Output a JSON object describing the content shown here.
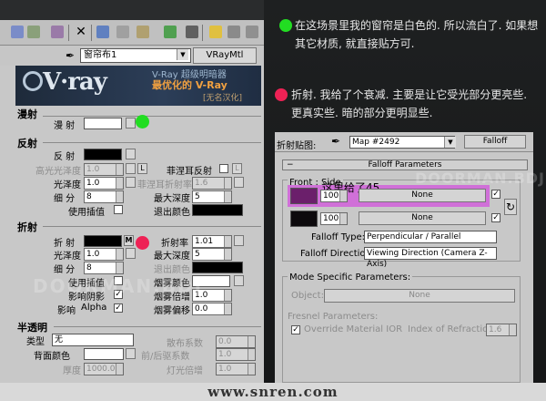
{
  "editor": {
    "map_name": "窗帘布1",
    "material_type": "VRayMtl",
    "banner": {
      "logo": "V·ray",
      "line1": "V-Ray 超级明暗器",
      "line2": "最优化的 V-Ray",
      "line3": "[无名汉化]"
    },
    "diffuse": {
      "header": "漫射",
      "label": "漫 射",
      "color": "#ffffff"
    },
    "reflection": {
      "header": "反射",
      "label": "反 射",
      "color": "#000000",
      "highlight_gloss_label": "高光光泽度",
      "highlight_gloss_value": "1.0",
      "lock_label": "L",
      "fresnel_label": "菲涅耳反射",
      "gloss_label": "光泽度",
      "gloss_value": "1.0",
      "fresnel_ior_label": "菲涅耳折射率",
      "fresnel_ior_value": "1.6",
      "subdivs_label": "细 分",
      "subdivs_value": "8",
      "max_depth_label": "最大深度",
      "max_depth_value": "5",
      "interp_label": "使用插值",
      "exit_color_label": "退出颜色"
    },
    "refraction": {
      "header": "折射",
      "label": "折 射",
      "color": "#000000",
      "m_button": "M",
      "ior_label": "折射率",
      "ior_value": "1.01",
      "gloss_label": "光泽度",
      "gloss_value": "1.0",
      "max_depth_label": "最大深度",
      "max_depth_value": "5",
      "subdivs_label": "细 分",
      "subdivs_value": "8",
      "exit_color_label": "退出颜色",
      "interp_label": "使用插值",
      "fog_color_label": "烟雾颜色",
      "affect_shadows_label": "影响阴影",
      "fog_mult_label": "烟雾倍增",
      "fog_mult_value": "1.0",
      "affect_label": "影响",
      "affect_value": "Alpha",
      "fog_bias_label": "烟雾偏移",
      "fog_bias_value": "0.0"
    },
    "translucency": {
      "header": "半透明",
      "type_label": "类型",
      "type_value": "无",
      "scatter_label": "散布系数",
      "scatter_value": "0.0",
      "back_color_label": "背面颜色",
      "fwd_back_label": "前/后驱系数",
      "fwd_back_value": "1.0",
      "thickness_label": "厚度",
      "thickness_value": "1000.0",
      "light_mult_label": "灯光倍增",
      "light_mult_value": "1.0"
    }
  },
  "notes": {
    "green": "在这场景里我的窗帘是白色的. 所以流白了. 如果想其它材质, 就直接贴方可.",
    "red": "折射. 我给了个衰减. 主要是让它受光部分更亮些. 更真实些. 暗的部分更明显些."
  },
  "falloff": {
    "label": "折射贴图:",
    "map_name": "Map #2492",
    "type_button": "Falloff",
    "rollout_title": "Falloff Parameters",
    "front_side_label": "Front : Side",
    "annotation": "这里给了45.",
    "slot1_value": "100.0",
    "slot1_map": "None",
    "slot1_color": "#6b1f6b",
    "slot2_value": "100.0",
    "slot2_map": "None",
    "slot2_color": "#0d0a0d",
    "falloff_type_label": "Falloff Type:",
    "falloff_type_value": "Perpendicular / Parallel",
    "falloff_dir_label": "Falloff Direction:",
    "falloff_dir_value": "Viewing Direction (Camera Z-Axis)",
    "mode_label": "Mode Specific Parameters:",
    "object_label": "Object:",
    "object_value": "None",
    "fresnel_label": "Fresnel Parameters:",
    "override_label": "Override Material IOR",
    "ior_label": "Index of Refraction",
    "ior_value": "1.6"
  },
  "watermarks": [
    "DOORMAN.BDJ",
    "DOORMAN.BDJ"
  ],
  "footer": "www.snren.com",
  "colors": {
    "green_marker": "#22dd22",
    "red_marker": "#ee2255",
    "highlight": "#d070d8"
  }
}
